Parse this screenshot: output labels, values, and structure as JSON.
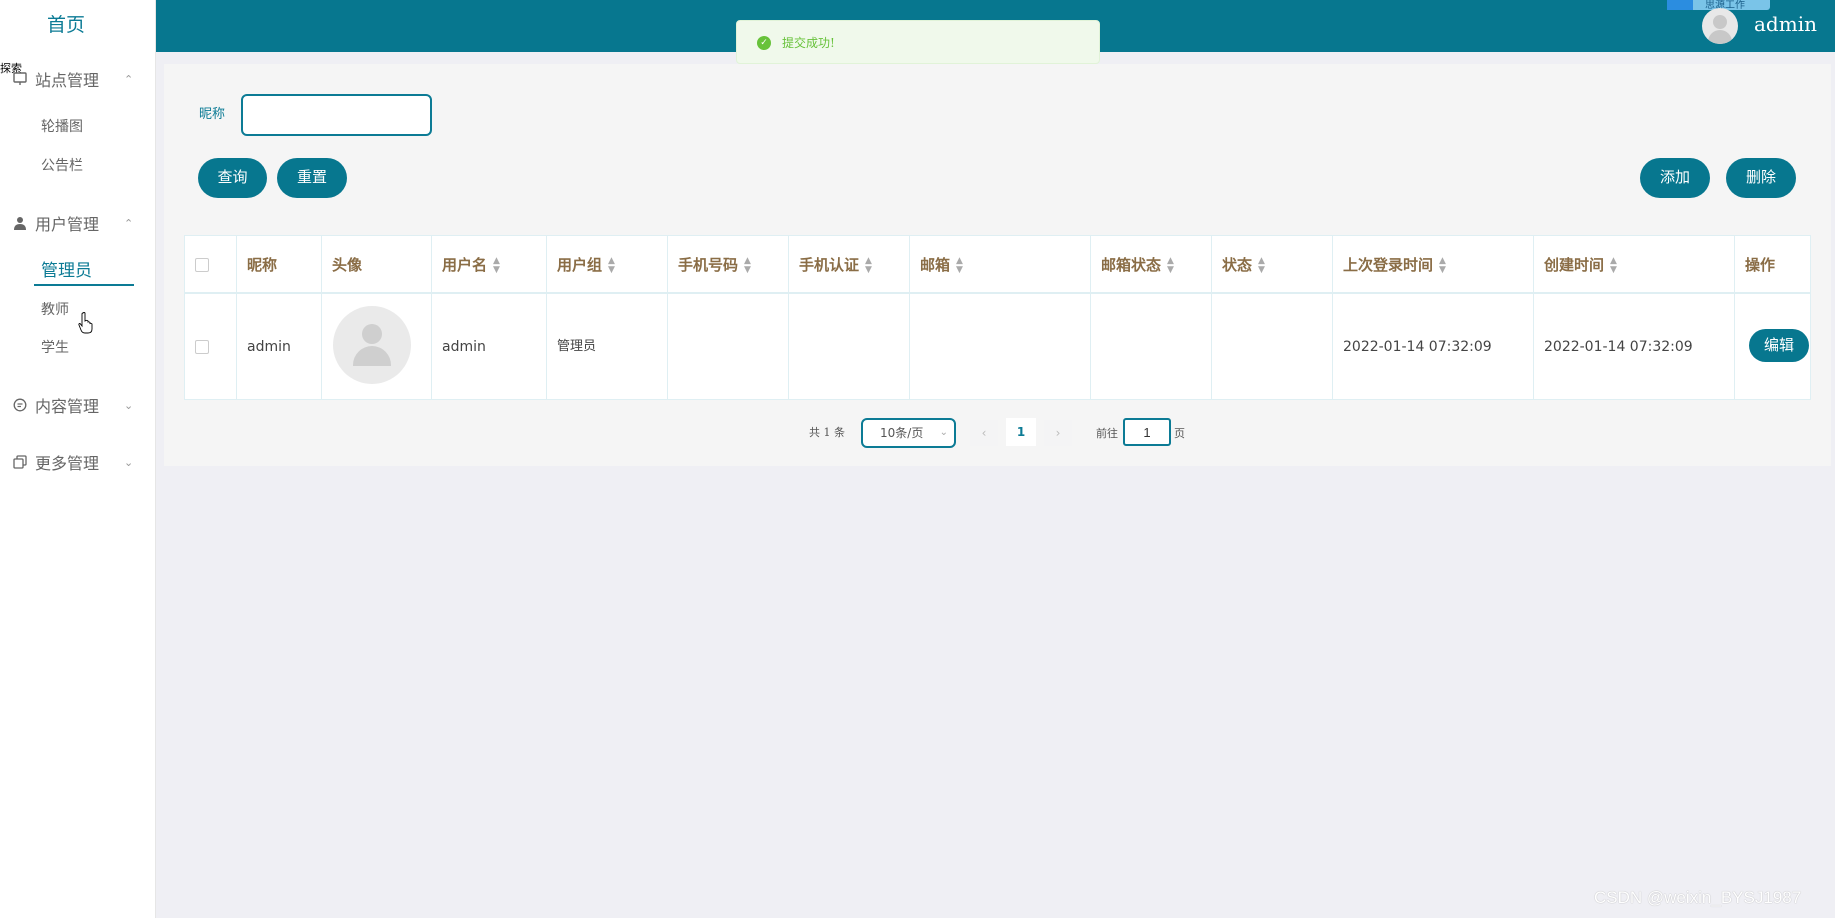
{
  "sidebar": {
    "home": "首页",
    "tooltip_fragment": "探索",
    "groups": [
      {
        "label": "站点管理",
        "icon": "monitor-icon",
        "arrow": "⌃",
        "items": [
          "轮播图",
          "公告栏"
        ]
      },
      {
        "label": "用户管理",
        "icon": "user-icon",
        "arrow": "⌃",
        "items": [
          "管理员",
          "教师",
          "学生"
        ]
      },
      {
        "label": "内容管理",
        "icon": "chat-icon",
        "arrow": "⌄",
        "items": []
      },
      {
        "label": "更多管理",
        "icon": "copy-icon",
        "arrow": "⌄",
        "items": []
      }
    ],
    "active_item": "管理员"
  },
  "topbar": {
    "user_name": "admin",
    "widget_text": "思源工作"
  },
  "toast": {
    "message": "提交成功!",
    "icon": "check-circle-icon",
    "color": "#67c23a"
  },
  "search": {
    "label": "昵称",
    "value": "",
    "query_button": "查询",
    "reset_button": "重置"
  },
  "actions": {
    "add_button": "添加",
    "delete_button": "删除"
  },
  "table": {
    "columns": [
      "昵称",
      "头像",
      "用户名",
      "用户组",
      "手机号码",
      "手机认证",
      "邮箱",
      "邮箱状态",
      "状态",
      "上次登录时间",
      "创建时间",
      "操作"
    ],
    "sortable": [
      false,
      false,
      true,
      true,
      true,
      true,
      true,
      true,
      true,
      true,
      true,
      false
    ],
    "rows": [
      {
        "nickname": "admin",
        "avatar": "default-avatar",
        "username": "admin",
        "group": "管理员",
        "phone": "",
        "phone_verified": "",
        "email": "",
        "email_status": "",
        "status": "",
        "last_login": "2022-01-14 07:32:09",
        "created": "2022-01-14 07:32:09",
        "edit_button": "编辑"
      }
    ]
  },
  "pagination": {
    "total_text": "共 1 条",
    "page_size": "10条/页",
    "current_page": "1",
    "goto_label": "前往",
    "goto_value": "1",
    "page_suffix": "页"
  },
  "watermark": "CSDN @weixin_BYSJ1987",
  "colors": {
    "brand": "#07778f",
    "header_text": "#8a6d46",
    "background": "#efeff4"
  }
}
